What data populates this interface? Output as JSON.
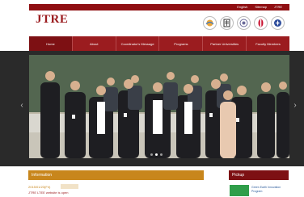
{
  "top_links": [
    "English",
    "Sitemap",
    "JTRE"
  ],
  "logo": {
    "mark": "JTRE",
    "subtitle_line1": "",
    "subtitle_line2": ""
  },
  "partner_logos": [
    {
      "name": "partner-logo-1-icon",
      "color": "#e8a53a"
    },
    {
      "name": "partner-logo-2-icon",
      "color": "#333333"
    },
    {
      "name": "partner-logo-3-icon",
      "color": "#6a6a9a"
    },
    {
      "name": "partner-logo-4-icon",
      "color": "#c8102e"
    },
    {
      "name": "partner-logo-5-icon",
      "color": "#2a4a9a"
    }
  ],
  "nav": [
    {
      "label": "Home",
      "active": true
    },
    {
      "label": "About",
      "active": false
    },
    {
      "label": "Coordinator's Message",
      "active": false
    },
    {
      "label": "Programs",
      "active": false
    },
    {
      "label": "Partner Universities",
      "active": false
    },
    {
      "label": "Faculty Members",
      "active": false
    }
  ],
  "slider": {
    "slide_count": 3,
    "active_slide": 2
  },
  "information": {
    "heading": "Information",
    "date": "2015/01/23(Fri)",
    "badge": "",
    "text": "JTRE LTEE website is open"
  },
  "pickup": {
    "heading": "Pickup",
    "link_text": "Green Earth Innovation Program"
  },
  "colors": {
    "brand_red": "#9b1c1f",
    "nav_active": "#7d1013",
    "info_gold": "#c8861c"
  }
}
